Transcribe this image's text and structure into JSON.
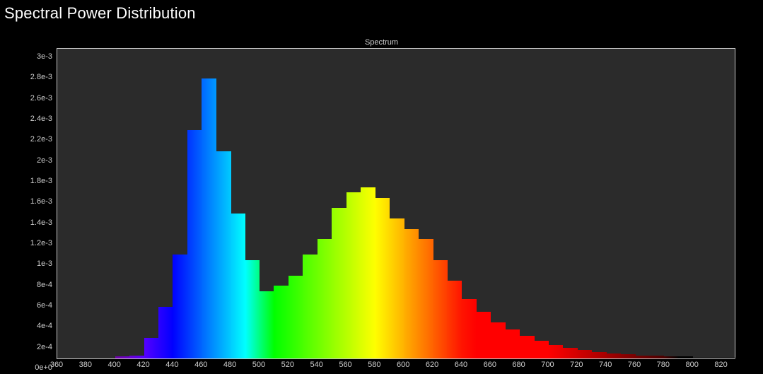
{
  "page_title": "Spectral Power Distribution",
  "chart_data": {
    "type": "bar",
    "title": "Spectrum",
    "xlabel": "",
    "ylabel": "",
    "xlim": [
      360,
      830
    ],
    "ylim": [
      0,
      0.003
    ],
    "xticks": [
      360,
      380,
      400,
      420,
      440,
      460,
      480,
      500,
      520,
      540,
      560,
      580,
      600,
      620,
      640,
      660,
      680,
      700,
      720,
      740,
      760,
      780,
      800,
      820
    ],
    "yticks": [
      0,
      0.0002,
      0.0004,
      0.0006,
      0.0008,
      0.001,
      0.0012,
      0.0014,
      0.0016,
      0.0018,
      0.002,
      0.0022,
      0.0024,
      0.0026,
      0.0028,
      0.003
    ],
    "ytick_labels": [
      "0e+0",
      "2e-4",
      "4e-4",
      "6e-4",
      "8e-4",
      "1e-3",
      "1.2e-3",
      "1.4e-3",
      "1.6e-3",
      "1.8e-3",
      "2e-3",
      "2.2e-3",
      "2.4e-3",
      "2.6e-3",
      "2.8e-3",
      "3e-3"
    ],
    "bin_width_nm": 10,
    "series": [
      {
        "name": "Spectrum",
        "x_start_nm": [
          400,
          410,
          420,
          430,
          440,
          450,
          460,
          470,
          480,
          490,
          500,
          510,
          520,
          530,
          540,
          550,
          560,
          570,
          580,
          590,
          600,
          610,
          620,
          630,
          640,
          650,
          660,
          670,
          680,
          690,
          700,
          710,
          720,
          730,
          740,
          750,
          760,
          770,
          780,
          790,
          800,
          810,
          820
        ],
        "values": [
          2e-05,
          3e-05,
          0.0002,
          0.0005,
          0.001,
          0.0022,
          0.0027,
          0.002,
          0.0014,
          0.00095,
          0.00065,
          0.0007,
          0.0008,
          0.001,
          0.00115,
          0.00145,
          0.0016,
          0.00165,
          0.00155,
          0.00135,
          0.00125,
          0.00115,
          0.00095,
          0.00075,
          0.00057,
          0.00045,
          0.00035,
          0.00028,
          0.00022,
          0.00017,
          0.00013,
          0.0001,
          8e-05,
          6e-05,
          5e-05,
          4e-05,
          3e-05,
          3e-05,
          2e-05,
          2e-05,
          1e-05,
          1e-05,
          1e-05
        ]
      }
    ],
    "colors": {
      "plot_bg": "#2b2b2b",
      "axis": "#c8c8c8",
      "text": "#cfcfcf"
    }
  }
}
